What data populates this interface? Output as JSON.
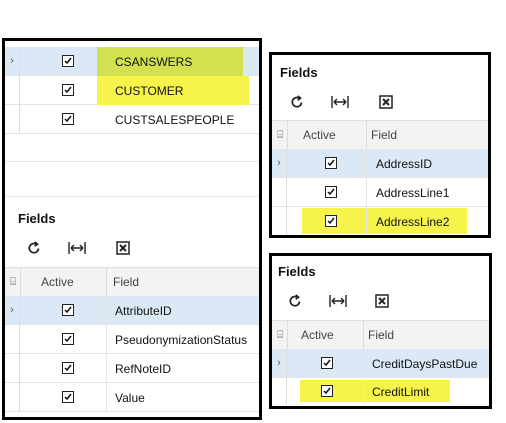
{
  "left_panel": {
    "tables": [
      {
        "name": "CSANSWERS",
        "active": true,
        "highlight": "dark"
      },
      {
        "name": "CUSTOMER",
        "active": true,
        "highlight": "yellow"
      },
      {
        "name": "CUSTSALESPEOPLE",
        "active": true,
        "highlight": "none"
      }
    ],
    "fields_title": "Fields",
    "columns": {
      "active": "Active",
      "field": "Field"
    },
    "fields": [
      {
        "name": "AttributeID",
        "active": true
      },
      {
        "name": "PseudonymizationStatus",
        "active": true
      },
      {
        "name": "RefNoteID",
        "active": true
      },
      {
        "name": "Value",
        "active": true
      }
    ]
  },
  "right_top_panel": {
    "fields_title": "Fields",
    "columns": {
      "active": "Active",
      "field": "Field"
    },
    "fields": [
      {
        "name": "AddressID",
        "active": true,
        "highlight": "none"
      },
      {
        "name": "AddressLine1",
        "active": true,
        "highlight": "none"
      },
      {
        "name": "AddressLine2",
        "active": true,
        "highlight": "yellow"
      }
    ]
  },
  "right_bottom_panel": {
    "fields_title": "Fields",
    "columns": {
      "active": "Active",
      "field": "Field"
    },
    "fields": [
      {
        "name": "CreditDaysPastDue",
        "active": true,
        "highlight": "none"
      },
      {
        "name": "CreditLimit",
        "active": true,
        "highlight": "yellow"
      }
    ]
  },
  "toolbar_icons": [
    "refresh-icon",
    "fit-columns-icon",
    "export-excel-icon"
  ],
  "colors": {
    "highlight_yellow": "#f6f44a",
    "highlight_dark": "#d2e150",
    "selected_row": "#dbe9f7"
  }
}
